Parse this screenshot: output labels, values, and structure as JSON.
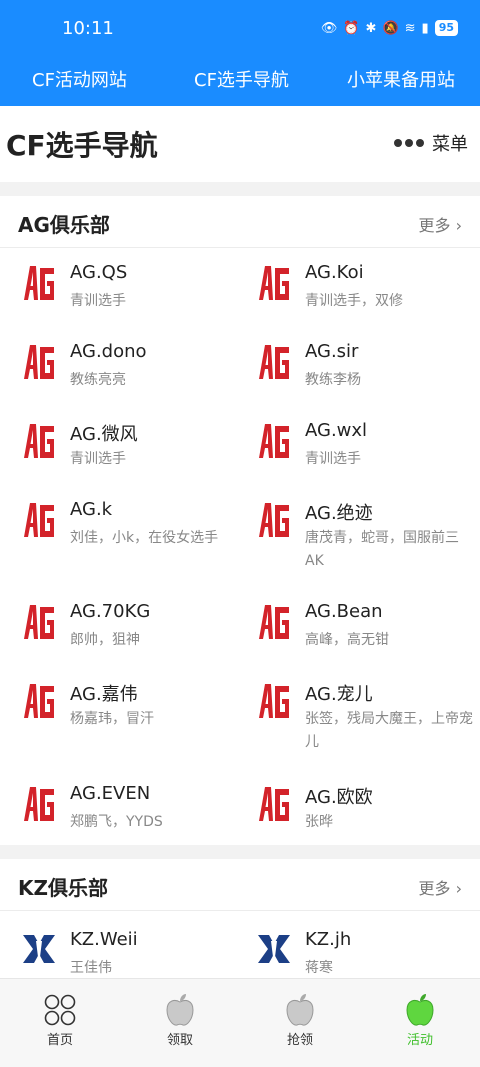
{
  "status_bar": {
    "time": "10:11",
    "battery": "95"
  },
  "quick_nav": [
    "CF活动网站",
    "CF选手导航",
    "小苹果备用站"
  ],
  "header": {
    "title": "CF选手导航",
    "menu_label": "菜单"
  },
  "sections": [
    {
      "name": "AG俱乐部",
      "more": "更多 ›",
      "logo": "AG",
      "players": [
        {
          "name": "AG.QS",
          "desc": "青训选手"
        },
        {
          "name": "AG.Koi",
          "desc": "青训选手，双修"
        },
        {
          "name": "AG.dono",
          "desc": "教练亮亮"
        },
        {
          "name": "AG.sir",
          "desc": "教练李杨"
        },
        {
          "name": "AG.微风",
          "desc": "青训选手"
        },
        {
          "name": "AG.wxl",
          "desc": "青训选手"
        },
        {
          "name": "AG.k",
          "desc": "刘佳，小k，在役女选手"
        },
        {
          "name": "AG.绝迹",
          "desc": "唐茂青，蛇哥，国服前三AK"
        },
        {
          "name": "AG.70KG",
          "desc": "郎帅，狙神"
        },
        {
          "name": "AG.Bean",
          "desc": "高峰，高无钳"
        },
        {
          "name": "AG.嘉伟",
          "desc": "杨嘉玮，冒汗"
        },
        {
          "name": "AG.宠儿",
          "desc": "张签，残局大魔王，上帝宠儿"
        },
        {
          "name": "AG.EVEN",
          "desc": "郑鹏飞，YYDS"
        },
        {
          "name": "AG.欧欧",
          "desc": "张晔"
        }
      ]
    },
    {
      "name": "KZ俱乐部",
      "more": "更多 ›",
      "logo": "KZ",
      "players": [
        {
          "name": "KZ.Weii",
          "desc": "王佳伟"
        },
        {
          "name": "KZ.jh",
          "desc": "蒋寒"
        }
      ]
    }
  ],
  "bottom_tabs": [
    {
      "label": "首页",
      "icon": "grid-icon",
      "active": false
    },
    {
      "label": "领取",
      "icon": "apple-icon",
      "active": false
    },
    {
      "label": "抢领",
      "icon": "apple-icon",
      "active": false
    },
    {
      "label": "活动",
      "icon": "apple-icon",
      "active": true
    }
  ],
  "colors": {
    "brand_blue": "#1a8cff",
    "ag_red": "#d3232a",
    "kz_blue": "#1c3f86",
    "active_green": "#3fbf2b"
  }
}
